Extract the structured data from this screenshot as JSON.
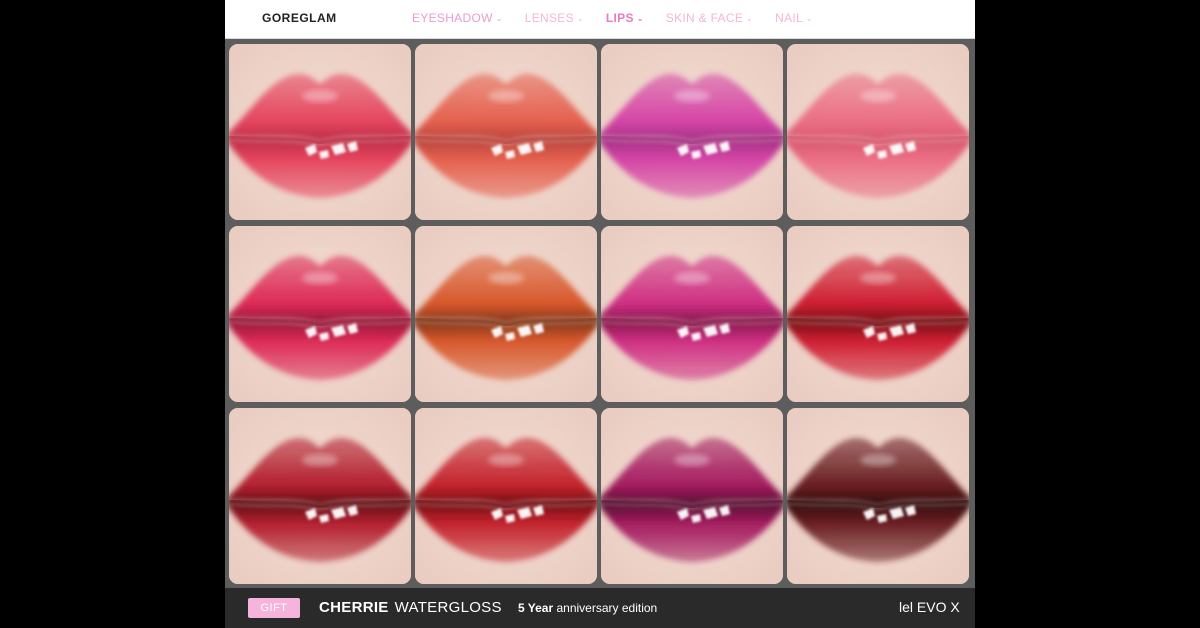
{
  "nav": {
    "brand": "GOREGLAM",
    "items": [
      {
        "label": "EYESHADOW",
        "state": "primary"
      },
      {
        "label": "LENSES",
        "state": "normal"
      },
      {
        "label": "LIPS",
        "state": "active"
      },
      {
        "label": "SKIN & FACE",
        "state": "normal"
      },
      {
        "label": "NAIL",
        "state": "normal"
      }
    ],
    "chevron": "⌄"
  },
  "swatches": [
    {
      "color": "#e5455e",
      "dark": "#b82b45"
    },
    {
      "color": "#e5604e",
      "dark": "#b5413a"
    },
    {
      "color": "#d545a6",
      "dark": "#9e2f82"
    },
    {
      "color": "#eb6f84",
      "dark": "#d6566e"
    },
    {
      "color": "#dd2a57",
      "dark": "#8e1838"
    },
    {
      "color": "#d8582c",
      "dark": "#7a3418"
    },
    {
      "color": "#cf2f83",
      "dark": "#7f1648"
    },
    {
      "color": "#cf1f33",
      "dark": "#6e1015"
    },
    {
      "color": "#b3202f",
      "dark": "#5a1016"
    },
    {
      "color": "#c4222c",
      "dark": "#6a0f13"
    },
    {
      "color": "#a41b5f",
      "dark": "#4d0d2d"
    },
    {
      "color": "#6a1e22",
      "dark": "#2b0b0c"
    }
  ],
  "footer": {
    "gift": "GIFT",
    "product_bold": "CHERRIE",
    "product_light": "WATERGLOSS",
    "edition_bold": "5 Year",
    "edition_rest": " anniversary edition",
    "evo": "lel EVO X"
  }
}
